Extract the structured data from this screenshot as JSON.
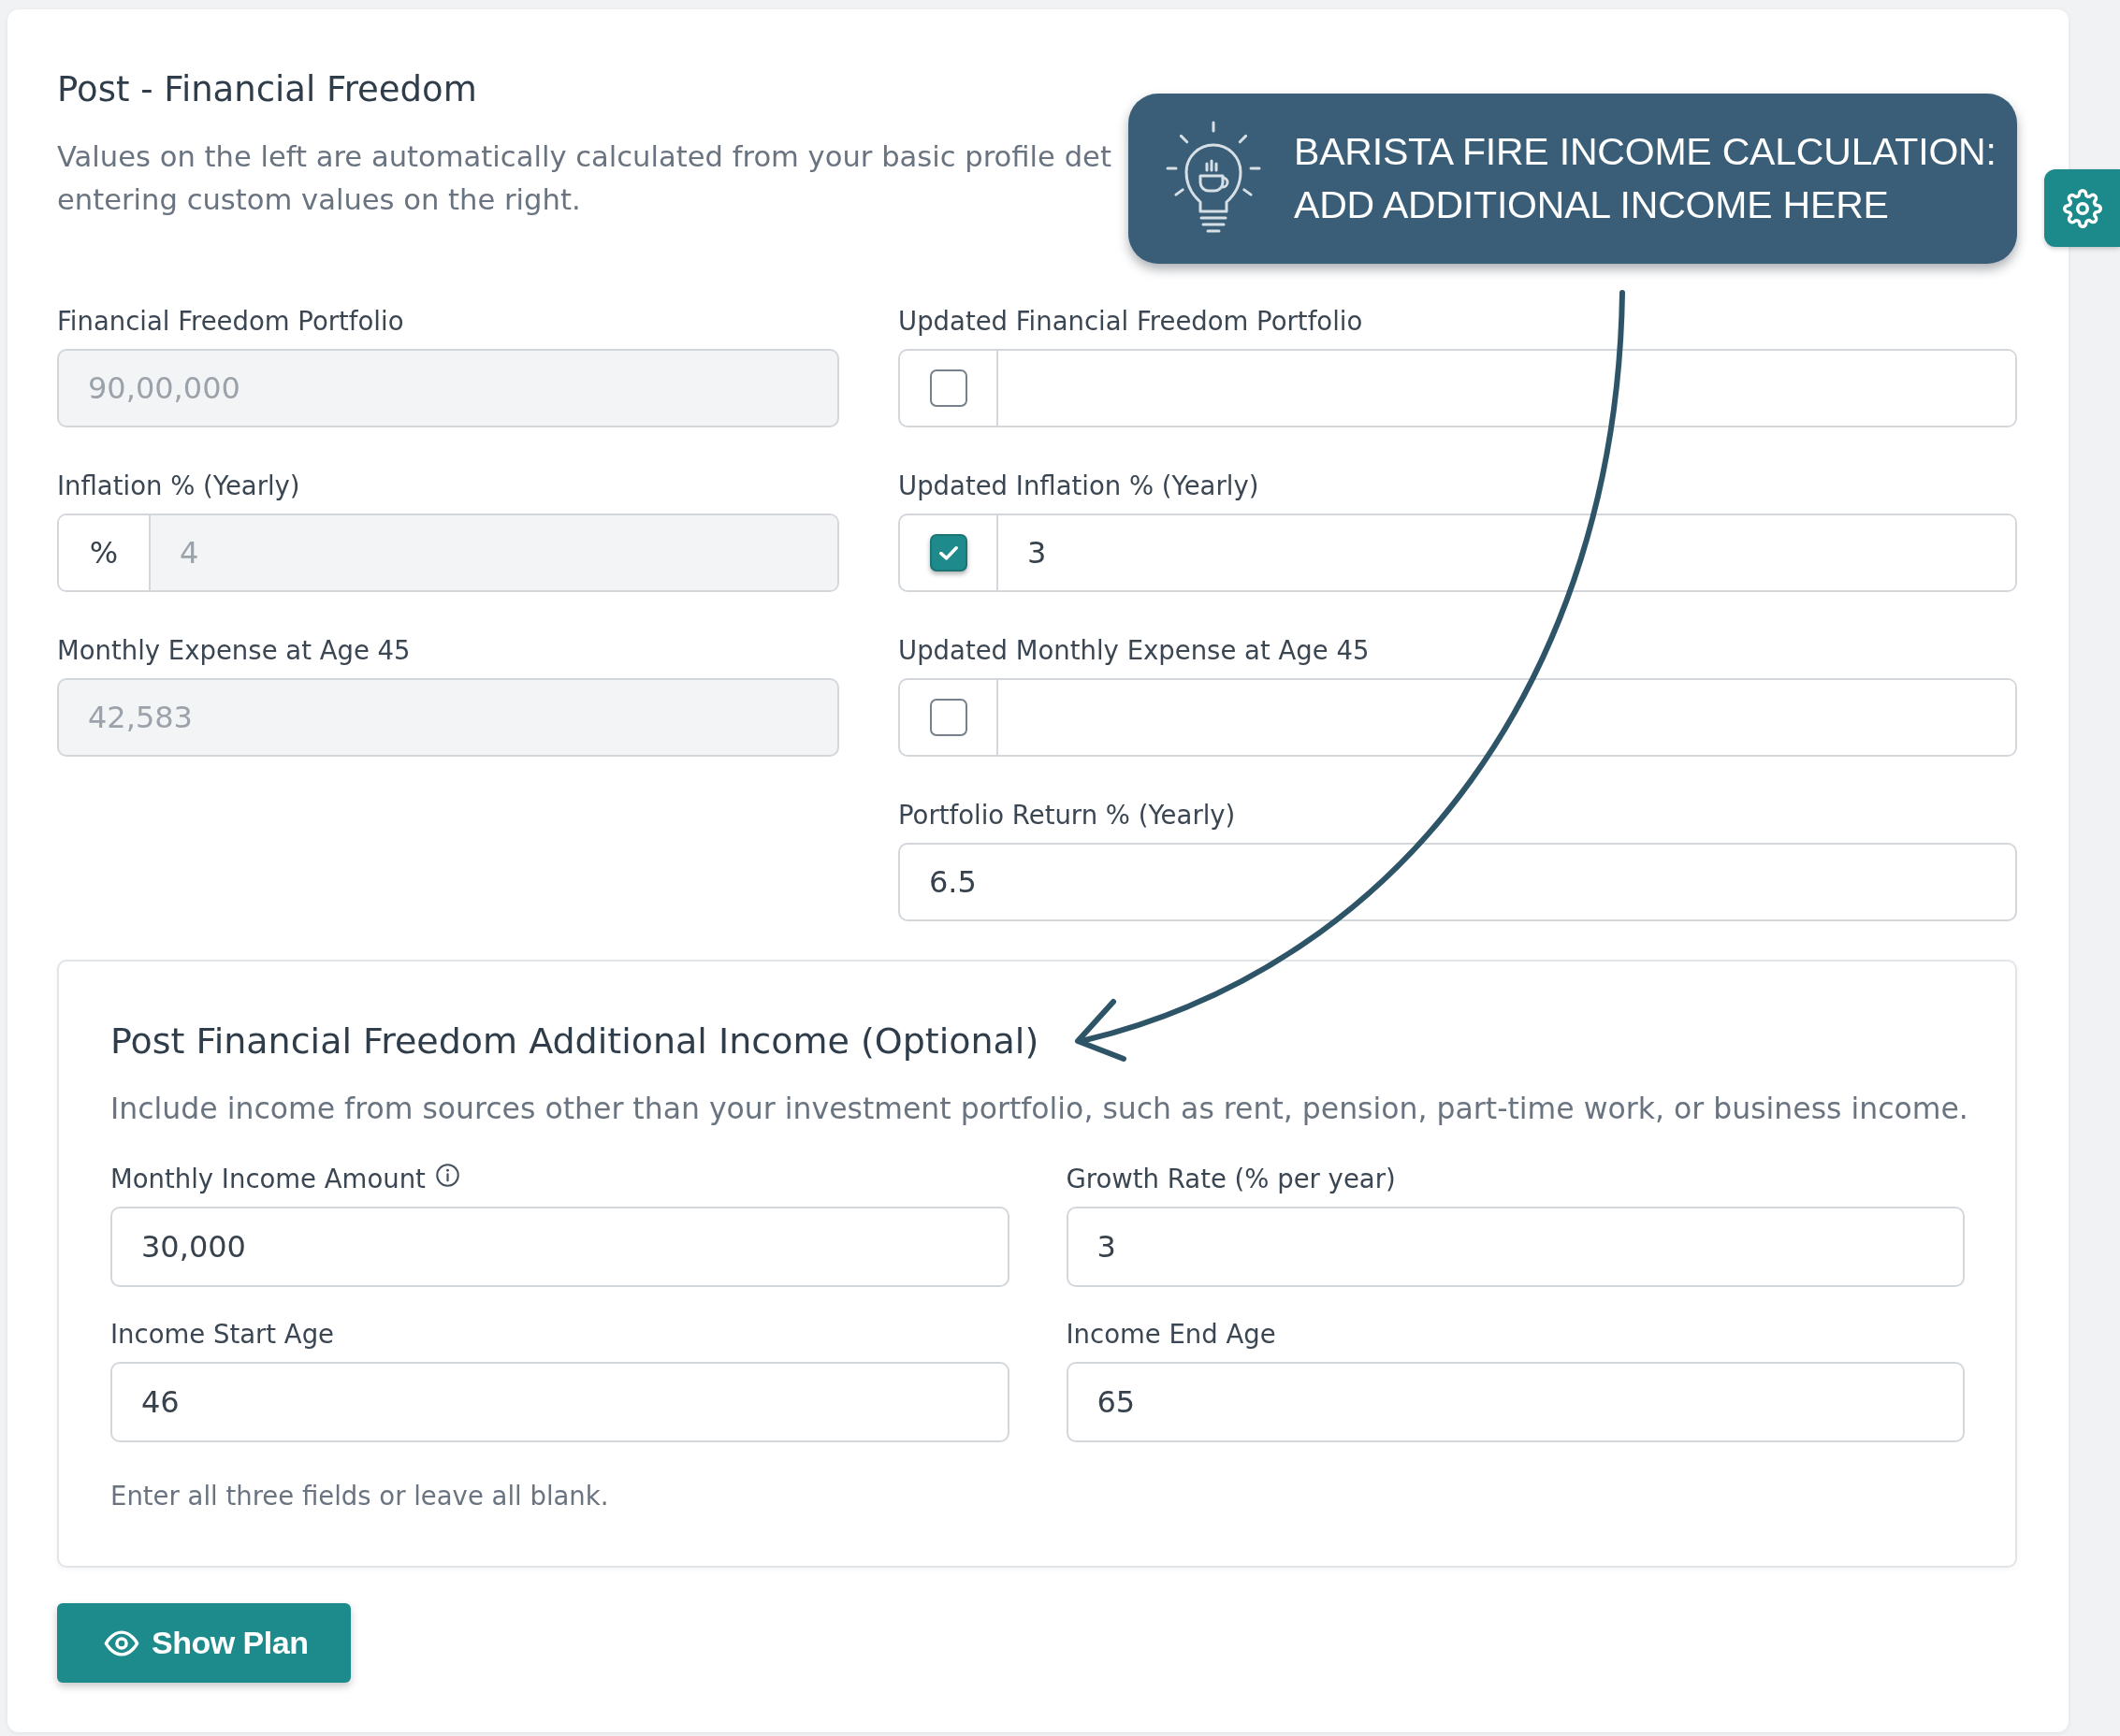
{
  "section": {
    "title": "Post - Financial Freedom",
    "description_lines": [
      "Values on the left are automatically calculated from your basic profile det",
      "entering custom values on the right."
    ]
  },
  "callout": {
    "text": "BARISTA FIRE INCOME CALCULATION: ADD ADDITIONAL INCOME HERE"
  },
  "left_fields": [
    {
      "kind": "plain",
      "label": "Financial Freedom Portfolio",
      "value": "90,00,000",
      "disabled": true
    },
    {
      "kind": "prefixed",
      "label": "Inflation % (Yearly)",
      "prefix": "%",
      "value": "4",
      "disabled": true
    },
    {
      "kind": "plain",
      "label": "Monthly Expense at Age 45",
      "value": "42,583",
      "disabled": true
    }
  ],
  "right_fields": [
    {
      "kind": "checkbox",
      "label": "Updated Financial Freedom Portfolio",
      "checked": false,
      "disabled": false
    },
    {
      "kind": "checkbox",
      "label": "Updated Inflation % (Yearly)",
      "checked": true,
      "value": "3",
      "disabled": false
    },
    {
      "kind": "checkbox",
      "label": "Updated Monthly Expense at Age 45",
      "checked": false,
      "disabled": false
    },
    {
      "kind": "plain",
      "label": "Portfolio Return % (Yearly)",
      "value": "6.5",
      "disabled": false
    }
  ],
  "additional_income": {
    "title": "Post Financial Freedom Additional Income (Optional)",
    "description": "Include income from sources other than your investment portfolio, such as rent, pension, part-time work, or business income.",
    "fields": [
      {
        "label": "Monthly Income Amount",
        "value": "30,000",
        "info_icon": true
      },
      {
        "label": "Growth Rate (% per year)",
        "value": "3",
        "info_icon": false
      },
      {
        "label": "Income Start Age",
        "value": "46",
        "info_icon": false
      },
      {
        "label": "Income End Age",
        "value": "65",
        "info_icon": false
      }
    ],
    "note": "Enter all three fields or leave all blank."
  },
  "show_plan_button": {
    "label": "Show Plan"
  }
}
